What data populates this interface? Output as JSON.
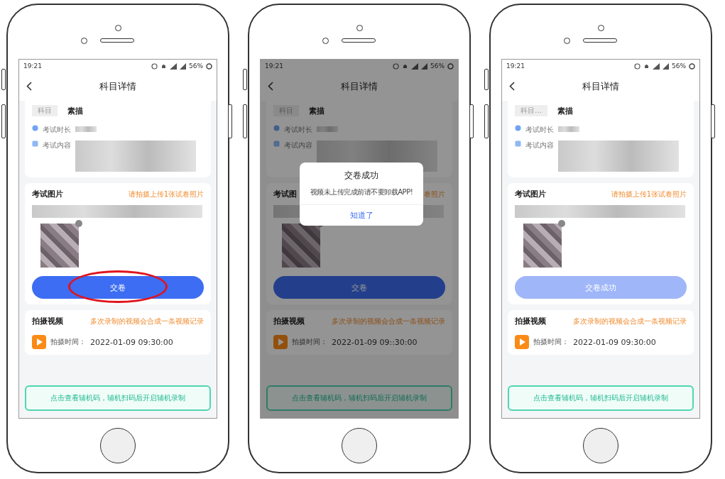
{
  "phones": [
    {
      "status_bar": {
        "time": "19:21",
        "battery": "56%"
      },
      "nav": {
        "title": "科目详情"
      },
      "subject": {
        "tag": "科目",
        "name": "素描"
      },
      "duration_label": "考试时长",
      "content_label": "考试内容",
      "photos_section": {
        "title": "考试图片",
        "hint": "请拍摄上传1张试卷照片"
      },
      "submit_button": {
        "label": "交卷",
        "disabled": false,
        "circled": true
      },
      "video_section": {
        "title": "拍摄视频",
        "hint": "多次录制的视频会合成一条视频记录",
        "time_label": "拍摄时间：",
        "time_value": "2022-01-09 09:30:00"
      },
      "helper_bar": {
        "text": "点击查看辅机码，辅机扫码后开启辅机录制"
      }
    },
    {
      "status_bar": {
        "time": "19:21",
        "battery": "56%"
      },
      "nav": {
        "title": "科目详情"
      },
      "subject": {
        "tag": "科目",
        "name": "素描"
      },
      "duration_label": "考试时长",
      "content_label": "考试内容",
      "photos_section": {
        "title": "考试图",
        "hint": "卷照片"
      },
      "submit_button": {
        "label": "交卷",
        "disabled": false,
        "circled": false
      },
      "video_section": {
        "title": "拍摄视频",
        "hint": "多次录制的视频会合成一条视频记录",
        "time_label": "拍摄时间：",
        "time_value": "2022-01-09 09::30:00"
      },
      "helper_bar": {
        "text": "点击查看辅机码，辅机扫码后开启辅机录制"
      },
      "dialog": {
        "title": "交卷成功",
        "message": "视频未上传完成前请不要卸载APP!",
        "button": "知道了"
      }
    },
    {
      "status_bar": {
        "time": "19:21",
        "battery": "56%"
      },
      "nav": {
        "title": "科目详情"
      },
      "subject": {
        "tag": "科目…",
        "name": "素描"
      },
      "duration_label": "考试时长",
      "content_label": "考试内容",
      "photos_section": {
        "title": "考试图片",
        "hint": "请拍摄上传1张试卷照片"
      },
      "submit_button": {
        "label": "交卷成功",
        "disabled": true,
        "circled": false
      },
      "video_section": {
        "title": "拍摄视频",
        "hint": "多次录制的视频会合成一条视频记录",
        "time_label": "拍摄时间：",
        "time_value": "2022-01-09 09:30:00"
      },
      "helper_bar": {
        "text": "点击查看辅机码，辅机扫码后开启辅机录制"
      }
    }
  ]
}
